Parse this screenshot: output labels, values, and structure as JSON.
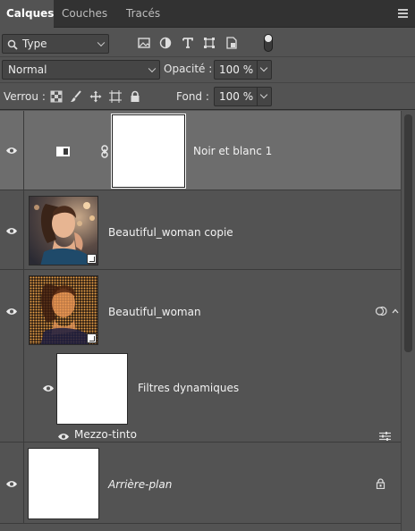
{
  "tabs": [
    {
      "label": "Calques",
      "active": true
    },
    {
      "label": "Couches",
      "active": false
    },
    {
      "label": "Tracés",
      "active": false
    }
  ],
  "filter": {
    "type_label": "Type",
    "icons": [
      "image-filter-icon",
      "adjustment-filter-icon",
      "text-filter-icon",
      "shape-filter-icon",
      "smart-object-filter-icon"
    ]
  },
  "blend": {
    "mode": "Normal",
    "opacity_label": "Opacité :",
    "opacity_value": "100 %",
    "fill_label": "Fond :",
    "fill_value": "100 %"
  },
  "lock": {
    "label": "Verrou :"
  },
  "layers": {
    "bw": {
      "name": "Noir et blanc 1"
    },
    "copy": {
      "name": "Beautiful_woman  copie"
    },
    "base": {
      "name": "Beautiful_woman"
    },
    "filters": {
      "name": "Filtres dynamiques",
      "filter_name": "Mezzo-tinto"
    },
    "background": {
      "name": "Arrière-plan"
    }
  },
  "colors": {
    "panel_bg": "#535353",
    "selected_row": "#6d6d6d",
    "tabbar_bg": "#323232"
  }
}
